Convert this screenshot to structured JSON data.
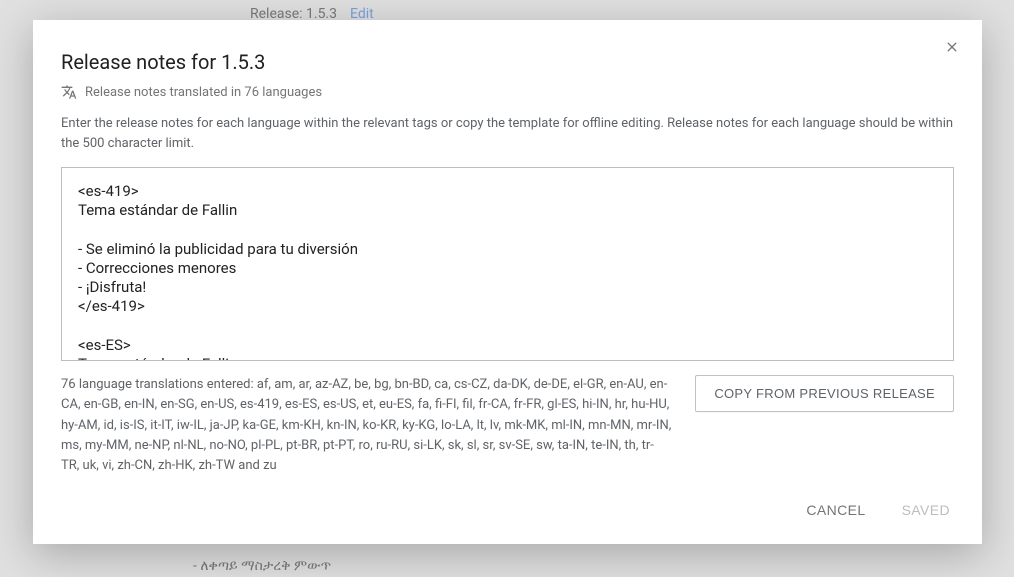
{
  "background": {
    "release_label": "Release: 1.5.3",
    "edit": "Edit",
    "bottom_text": "- ለቀጣይ ማስታረቅ ምውጥ"
  },
  "dialog": {
    "title": "Release notes for 1.5.3",
    "subtitle": "Release notes translated in 76 languages",
    "instructions": "Enter the release notes for each language within the relevant tags or copy the template for offline editing. Release notes for each language should be within the 500 character limit.",
    "textarea_content": "<es-419>\nTema estándar de Fallin\n\n- Se eliminó la publicidad para tu diversión\n- Correcciones menores\n- ¡Disfruta!\n</es-419>\n\n<es-ES>\nTema estándar de Fallin",
    "lang_summary": "76 language translations entered: af, am, ar, az-AZ, be, bg, bn-BD, ca, cs-CZ, da-DK, de-DE, el-GR, en-AU, en-CA, en-GB, en-IN, en-SG, en-US, es-419, es-ES, es-US, et, eu-ES, fa, fi-FI, fil, fr-CA, fr-FR, gl-ES, hi-IN, hr, hu-HU, hy-AM, id, is-IS, it-IT, iw-IL, ja-JP, ka-GE, km-KH, kn-IN, ko-KR, ky-KG, lo-LA, lt, lv, mk-MK, ml-IN, mn-MN, mr-IN, ms, my-MM, ne-NP, nl-NL, no-NO, pl-PL, pt-BR, pt-PT, ro, ru-RU, si-LK, sk, sl, sr, sv-SE, sw, ta-IN, te-IN, th, tr-TR, uk, vi, zh-CN, zh-HK, zh-TW and zu",
    "copy_btn": "COPY FROM PREVIOUS RELEASE",
    "cancel": "CANCEL",
    "saved": "SAVED"
  }
}
